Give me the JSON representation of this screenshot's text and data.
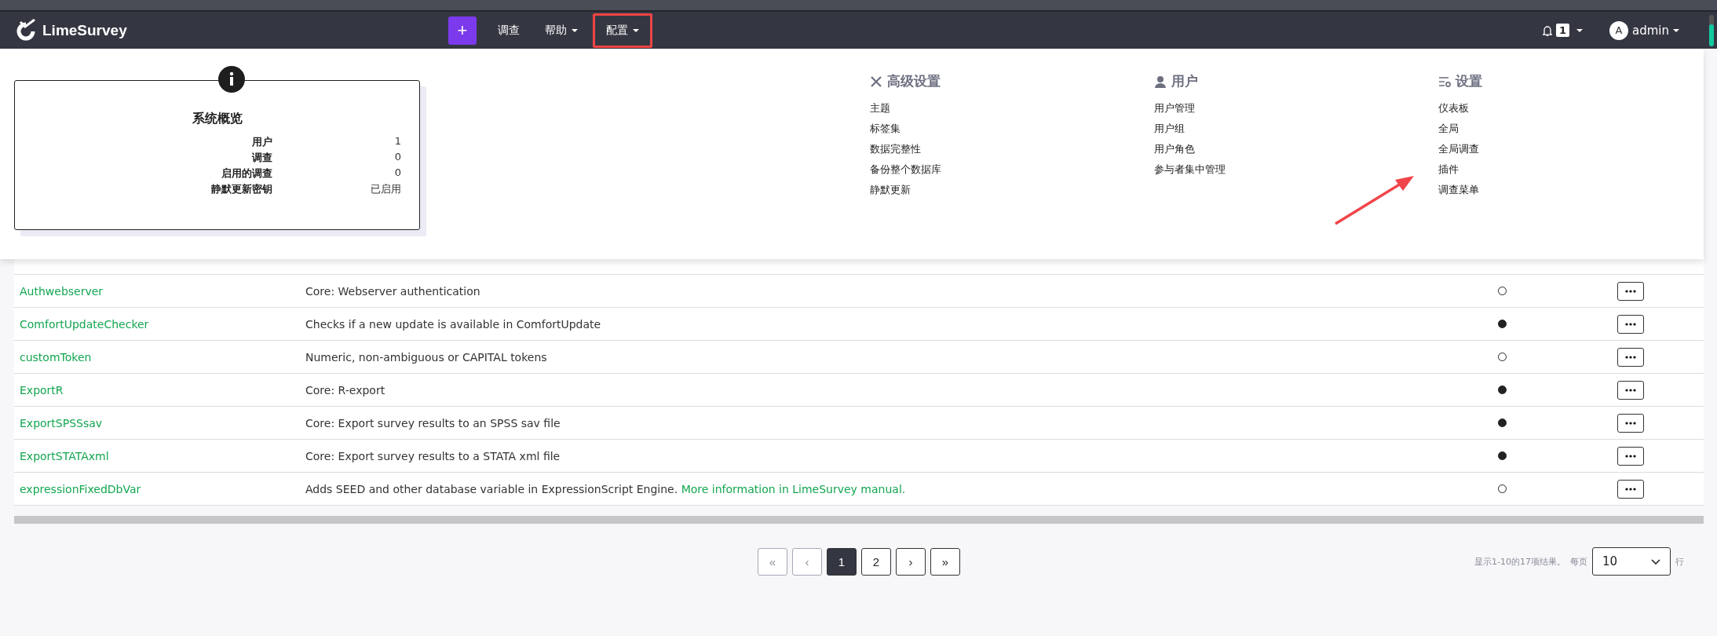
{
  "navbar": {
    "brand": "LimeSurvey",
    "create_button": "+",
    "items": [
      {
        "label": "调查",
        "has_caret": false,
        "highlighted": false
      },
      {
        "label": "帮助",
        "has_caret": true,
        "highlighted": false
      },
      {
        "label": "配置",
        "has_caret": true,
        "highlighted": true
      }
    ],
    "notifications": {
      "count": "1"
    },
    "user": {
      "avatar": "A",
      "name": "admin"
    }
  },
  "dropdown": {
    "pointer_arrow": true,
    "overview": {
      "title": "系统概览",
      "rows": [
        {
          "label": "用户",
          "value": "1"
        },
        {
          "label": "调查",
          "value": "0"
        },
        {
          "label": "启用的调查",
          "value": "0"
        },
        {
          "label": "静默更新密钥",
          "value": "已启用"
        }
      ]
    },
    "columns": [
      {
        "kind": "tools",
        "title": "高级设置",
        "items": [
          {
            "label": "主题"
          },
          {
            "label": "标签集"
          },
          {
            "label": "数据完整性"
          },
          {
            "label": "备份整个数据库"
          },
          {
            "label": "静默更新"
          }
        ]
      },
      {
        "kind": "user",
        "title": "用户",
        "items": [
          {
            "label": "用户管理"
          },
          {
            "label": "用户组"
          },
          {
            "label": "用户角色"
          },
          {
            "label": "参与者集中管理"
          }
        ]
      },
      {
        "kind": "settings",
        "title": "设置",
        "items": [
          {
            "label": "仪表板"
          },
          {
            "label": "全局"
          },
          {
            "label": "全局调查"
          },
          {
            "label": "插件"
          },
          {
            "label": "调查菜单"
          }
        ]
      }
    ]
  },
  "table": {
    "rows": [
      {
        "name": "Authwebserver",
        "description": "Core: Webserver authentication",
        "active": false
      },
      {
        "name": "ComfortUpdateChecker",
        "description": "Checks if a new update is available in ComfortUpdate",
        "active": true
      },
      {
        "name": "customToken",
        "description": "Numeric, non-ambiguous or CAPITAL tokens",
        "active": false
      },
      {
        "name": "ExportR",
        "description": "Core: R-export",
        "active": true
      },
      {
        "name": "ExportSPSSsav",
        "description": "Core: Export survey results to an SPSS sav file",
        "active": true
      },
      {
        "name": "ExportSTATAxml",
        "description": "Core: Export survey results to a STATA xml file",
        "active": true
      },
      {
        "name": "expressionFixedDbVar",
        "description": "Adds SEED and other database variable in ExpressionScript Engine.",
        "link": "More information in LimeSurvey manual.",
        "active": false
      }
    ]
  },
  "pagination": {
    "buttons": [
      {
        "label": "«",
        "selected": false,
        "disabled": true
      },
      {
        "label": "‹",
        "selected": false,
        "disabled": true
      },
      {
        "label": "1",
        "selected": true,
        "disabled": false
      },
      {
        "label": "2",
        "selected": false,
        "disabled": false
      },
      {
        "label": "›",
        "selected": false,
        "disabled": false
      },
      {
        "label": "»",
        "selected": false,
        "disabled": false
      }
    ],
    "summary": "显示1-10的17项结果。",
    "per_page_label": "每页",
    "per_page": "10",
    "rows_label": "行"
  }
}
